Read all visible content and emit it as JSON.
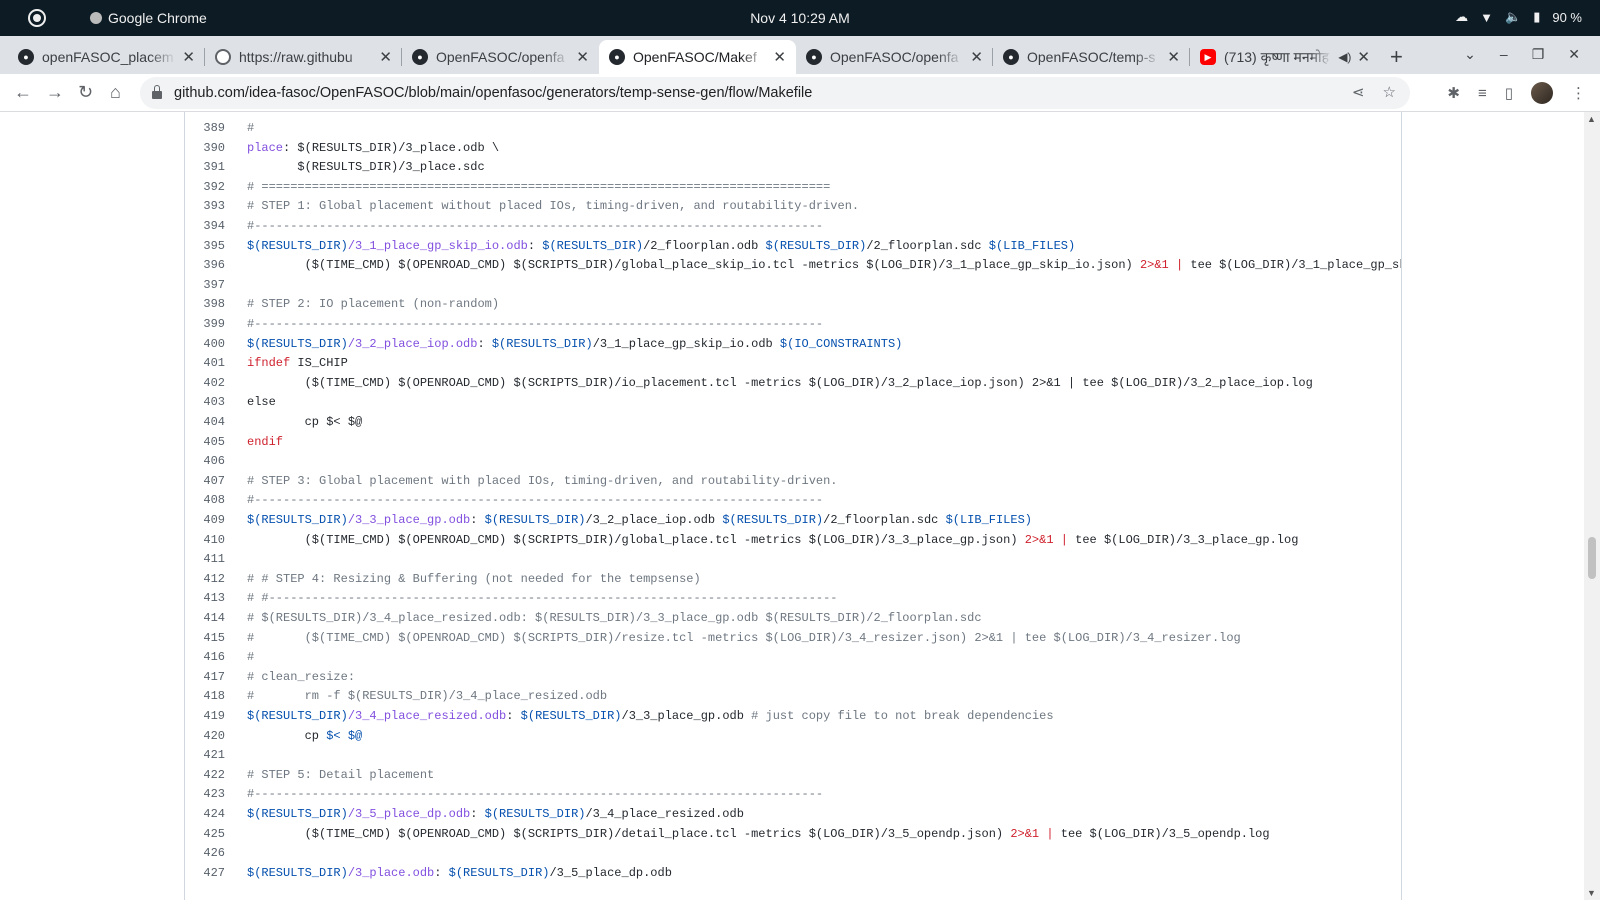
{
  "system_bar": {
    "app_name": "Google Chrome",
    "datetime": "Nov 4  10:29 AM",
    "battery": "90 %"
  },
  "tabs": [
    {
      "title": "openFASOC_placem",
      "icon": "github-icon",
      "active": false
    },
    {
      "title": "https://raw.githubu",
      "icon": "globe-icon",
      "active": false
    },
    {
      "title": "OpenFASOC/openfa",
      "icon": "github-icon",
      "active": false
    },
    {
      "title": "OpenFASOC/Makef",
      "icon": "github-icon",
      "active": true
    },
    {
      "title": "OpenFASOC/openfa",
      "icon": "github-icon",
      "active": false
    },
    {
      "title": "OpenFASOC/temp-s",
      "icon": "github-icon",
      "active": false
    },
    {
      "title": "(713) कृष्णा मनमोह",
      "icon": "youtube-icon",
      "active": false
    }
  ],
  "address_bar": {
    "url": "github.com/idea-fasoc/OpenFASOC/blob/main/openfasoc/generators/temp-sense-gen/flow/Makefile"
  },
  "code_lines": [
    {
      "n": "389",
      "spans": [
        {
          "t": "#",
          "c": "cm"
        }
      ]
    },
    {
      "n": "390",
      "spans": [
        {
          "t": "place",
          "c": "kw"
        },
        {
          "t": ": $(RESULTS_DIR)/3_place.odb \\",
          "c": ""
        }
      ]
    },
    {
      "n": "391",
      "spans": [
        {
          "t": "       $(RESULTS_DIR)/3_place.sdc",
          "c": ""
        }
      ]
    },
    {
      "n": "392",
      "spans": [
        {
          "t": "# ===============================================================================",
          "c": "cm"
        }
      ]
    },
    {
      "n": "393",
      "spans": [
        {
          "t": "# STEP 1: Global placement without placed IOs, timing-driven, and routability-driven.",
          "c": "cm"
        }
      ]
    },
    {
      "n": "394",
      "spans": [
        {
          "t": "#-------------------------------------------------------------------------------",
          "c": "cm"
        }
      ]
    },
    {
      "n": "395",
      "spans": [
        {
          "t": "$(RESULTS_DIR)",
          "c": "vr"
        },
        {
          "t": "/3_1_place_gp_skip_io.odb",
          "c": "kw"
        },
        {
          "t": ": ",
          "c": ""
        },
        {
          "t": "$(RESULTS_DIR)",
          "c": "vr"
        },
        {
          "t": "/2_floorplan.odb ",
          "c": ""
        },
        {
          "t": "$(RESULTS_DIR)",
          "c": "vr"
        },
        {
          "t": "/2_floorplan.sdc ",
          "c": ""
        },
        {
          "t": "$(LIB_FILES)",
          "c": "vr"
        }
      ]
    },
    {
      "n": "396",
      "spans": [
        {
          "t": "        ($(TIME_CMD) $(OPENROAD_CMD) $(SCRIPTS_DIR)/global_place_skip_io.tcl -metrics $(LOG_DIR)/3_1_place_gp_skip_io.json) ",
          "c": ""
        },
        {
          "t": "2>&1 | ",
          "c": "rd"
        },
        {
          "t": "tee $(LOG_DIR)/3_1_place_gp_sk",
          "c": ""
        }
      ]
    },
    {
      "n": "397",
      "spans": [
        {
          "t": "",
          "c": ""
        }
      ]
    },
    {
      "n": "398",
      "spans": [
        {
          "t": "# STEP 2: IO placement (non-random)",
          "c": "cm"
        }
      ]
    },
    {
      "n": "399",
      "spans": [
        {
          "t": "#-------------------------------------------------------------------------------",
          "c": "cm"
        }
      ]
    },
    {
      "n": "400",
      "spans": [
        {
          "t": "$(RESULTS_DIR)",
          "c": "vr"
        },
        {
          "t": "/3_2_place_iop.odb",
          "c": "kw"
        },
        {
          "t": ": ",
          "c": ""
        },
        {
          "t": "$(RESULTS_DIR)",
          "c": "vr"
        },
        {
          "t": "/3_1_place_gp_skip_io.odb ",
          "c": ""
        },
        {
          "t": "$(IO_CONSTRAINTS)",
          "c": "vr"
        }
      ]
    },
    {
      "n": "401",
      "spans": [
        {
          "t": "ifndef",
          "c": "rd"
        },
        {
          "t": " IS_CHIP",
          "c": ""
        }
      ]
    },
    {
      "n": "402",
      "spans": [
        {
          "t": "        ($(TIME_CMD) $(OPENROAD_CMD) $(SCRIPTS_DIR)/io_placement.tcl -metrics $(LOG_DIR)/3_2_place_iop.json) 2>&1 | tee $(LOG_DIR)/3_2_place_iop.log",
          "c": ""
        }
      ]
    },
    {
      "n": "403",
      "spans": [
        {
          "t": "else",
          "c": ""
        }
      ]
    },
    {
      "n": "404",
      "spans": [
        {
          "t": "        cp $< $@",
          "c": ""
        }
      ]
    },
    {
      "n": "405",
      "spans": [
        {
          "t": "endif",
          "c": "rd"
        }
      ]
    },
    {
      "n": "406",
      "spans": [
        {
          "t": "",
          "c": ""
        }
      ]
    },
    {
      "n": "407",
      "spans": [
        {
          "t": "# STEP 3: Global placement with placed IOs, timing-driven, and routability-driven.",
          "c": "cm"
        }
      ]
    },
    {
      "n": "408",
      "spans": [
        {
          "t": "#-------------------------------------------------------------------------------",
          "c": "cm"
        }
      ]
    },
    {
      "n": "409",
      "spans": [
        {
          "t": "$(RESULTS_DIR)",
          "c": "vr"
        },
        {
          "t": "/3_3_place_gp.odb",
          "c": "kw"
        },
        {
          "t": ": ",
          "c": ""
        },
        {
          "t": "$(RESULTS_DIR)",
          "c": "vr"
        },
        {
          "t": "/3_2_place_iop.odb ",
          "c": ""
        },
        {
          "t": "$(RESULTS_DIR)",
          "c": "vr"
        },
        {
          "t": "/2_floorplan.sdc ",
          "c": ""
        },
        {
          "t": "$(LIB_FILES)",
          "c": "vr"
        }
      ]
    },
    {
      "n": "410",
      "spans": [
        {
          "t": "        ($(TIME_CMD) $(OPENROAD_CMD) $(SCRIPTS_DIR)/global_place.tcl -metrics $(LOG_DIR)/3_3_place_gp.json) ",
          "c": ""
        },
        {
          "t": "2>&1 | ",
          "c": "rd"
        },
        {
          "t": "tee $(LOG_DIR)/3_3_place_gp.log",
          "c": ""
        }
      ]
    },
    {
      "n": "411",
      "spans": [
        {
          "t": "",
          "c": ""
        }
      ]
    },
    {
      "n": "412",
      "spans": [
        {
          "t": "# # STEP 4: Resizing & Buffering (not needed for the tempsense)",
          "c": "cm"
        }
      ]
    },
    {
      "n": "413",
      "spans": [
        {
          "t": "# #-------------------------------------------------------------------------------",
          "c": "cm"
        }
      ]
    },
    {
      "n": "414",
      "spans": [
        {
          "t": "# $(RESULTS_DIR)/3_4_place_resized.odb: $(RESULTS_DIR)/3_3_place_gp.odb $(RESULTS_DIR)/2_floorplan.sdc",
          "c": "cm"
        }
      ]
    },
    {
      "n": "415",
      "spans": [
        {
          "t": "#       ($(TIME_CMD) $(OPENROAD_CMD) $(SCRIPTS_DIR)/resize.tcl -metrics $(LOG_DIR)/3_4_resizer.json) 2>&1 | tee $(LOG_DIR)/3_4_resizer.log",
          "c": "cm"
        }
      ]
    },
    {
      "n": "416",
      "spans": [
        {
          "t": "#",
          "c": "cm"
        }
      ]
    },
    {
      "n": "417",
      "spans": [
        {
          "t": "# clean_resize:",
          "c": "cm"
        }
      ]
    },
    {
      "n": "418",
      "spans": [
        {
          "t": "#       rm -f $(RESULTS_DIR)/3_4_place_resized.odb",
          "c": "cm"
        }
      ]
    },
    {
      "n": "419",
      "spans": [
        {
          "t": "$(RESULTS_DIR)",
          "c": "vr"
        },
        {
          "t": "/3_4_place_resized.odb",
          "c": "kw"
        },
        {
          "t": ": ",
          "c": ""
        },
        {
          "t": "$(RESULTS_DIR)",
          "c": "vr"
        },
        {
          "t": "/3_3_place_gp.odb ",
          "c": ""
        },
        {
          "t": "# just copy file to not break dependencies",
          "c": "cm"
        }
      ]
    },
    {
      "n": "420",
      "spans": [
        {
          "t": "        cp ",
          "c": ""
        },
        {
          "t": "$<",
          "c": "vr"
        },
        {
          "t": " ",
          "c": ""
        },
        {
          "t": "$@",
          "c": "vr"
        }
      ]
    },
    {
      "n": "421",
      "spans": [
        {
          "t": "",
          "c": ""
        }
      ]
    },
    {
      "n": "422",
      "spans": [
        {
          "t": "# STEP 5: Detail placement",
          "c": "cm"
        }
      ]
    },
    {
      "n": "423",
      "spans": [
        {
          "t": "#-------------------------------------------------------------------------------",
          "c": "cm"
        }
      ]
    },
    {
      "n": "424",
      "spans": [
        {
          "t": "$(RESULTS_DIR)",
          "c": "vr"
        },
        {
          "t": "/3_5_place_dp.odb",
          "c": "kw"
        },
        {
          "t": ": ",
          "c": ""
        },
        {
          "t": "$(RESULTS_DIR)",
          "c": "vr"
        },
        {
          "t": "/3_4_place_resized.odb",
          "c": ""
        }
      ]
    },
    {
      "n": "425",
      "spans": [
        {
          "t": "        ($(TIME_CMD) $(OPENROAD_CMD) $(SCRIPTS_DIR)/detail_place.tcl -metrics $(LOG_DIR)/3_5_opendp.json) ",
          "c": ""
        },
        {
          "t": "2>&1 | ",
          "c": "rd"
        },
        {
          "t": "tee $(LOG_DIR)/3_5_opendp.log",
          "c": ""
        }
      ]
    },
    {
      "n": "426",
      "spans": [
        {
          "t": "",
          "c": ""
        }
      ]
    },
    {
      "n": "427",
      "spans": [
        {
          "t": "$(RESULTS_DIR)",
          "c": "vr"
        },
        {
          "t": "/3_place.odb",
          "c": "kw"
        },
        {
          "t": ": ",
          "c": ""
        },
        {
          "t": "$(RESULTS_DIR)",
          "c": "vr"
        },
        {
          "t": "/3_5_place_dp.odb",
          "c": ""
        }
      ]
    }
  ],
  "colors": {
    "cm": "#6e7781",
    "kw": "#8250df",
    "vr": "#0550ae",
    "rd": "#cf222e"
  }
}
